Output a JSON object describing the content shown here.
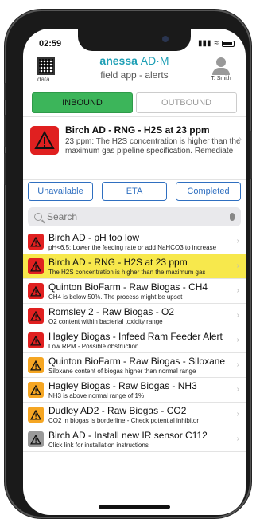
{
  "status": {
    "time": "02:59"
  },
  "header": {
    "qr_label": "data",
    "brand_part1": "anessa",
    "brand_part2": "AD·M",
    "subtitle": "field app - alerts",
    "user_name": "T. Smith"
  },
  "tabs": [
    {
      "label": "INBOUND",
      "active": true
    },
    {
      "label": "OUTBOUND",
      "active": false
    }
  ],
  "featured": {
    "title": "Birch AD - RNG - H2S at 23 ppm",
    "description": "23 ppm: The H2S concentration is higher than the maximum gas pipeline specification. Remediate by",
    "severity": "red"
  },
  "filters": [
    "Unavailable",
    "ETA",
    "Completed"
  ],
  "search": {
    "placeholder": "Search"
  },
  "alerts": [
    {
      "title": "Birch AD - pH too low",
      "desc": "pH<6.5: Lower the feeding rate or add NaHCO3 to increase",
      "severity": "red",
      "highlight": false
    },
    {
      "title": "Birch AD - RNG - H2S at 23 ppm",
      "desc": "The H2S concentration is higher than the maximum gas",
      "severity": "red",
      "highlight": true
    },
    {
      "title": "Quinton BioFarm - Raw Biogas - CH4",
      "desc": "CH4 is below 50%. The process might be upset",
      "severity": "red",
      "highlight": false
    },
    {
      "title": "Romsley 2 - Raw Biogas - O2",
      "desc": "O2 content within bacterial toxicity range",
      "severity": "red",
      "highlight": false
    },
    {
      "title": "Hagley Biogas - Infeed Ram Feeder Alert",
      "desc": "Low RPM - Possible obstruction",
      "severity": "red",
      "highlight": false
    },
    {
      "title": "Quinton BioFarm - Raw Biogas - Siloxane",
      "desc": "Siloxane content of biogas higher than normal range",
      "severity": "orange",
      "highlight": false
    },
    {
      "title": "Hagley Biogas - Raw Biogas - NH3",
      "desc": "NH3 is above normal range of 1%",
      "severity": "orange",
      "highlight": false
    },
    {
      "title": "Dudley AD2 - Raw Biogas - CO2",
      "desc": "CO2 in biogas is borderline - Check potential inhibitor",
      "severity": "orange",
      "highlight": false
    },
    {
      "title": "Birch AD - Install new IR sensor C112",
      "desc": "Click link for installation instructions",
      "severity": "gray",
      "highlight": false
    }
  ],
  "colors": {
    "red": "#e02020",
    "orange": "#f5a623",
    "gray": "#9a9a9a",
    "highlight": "#f7e84c",
    "accent": "#3cb55a",
    "link": "#2f6fc0"
  }
}
